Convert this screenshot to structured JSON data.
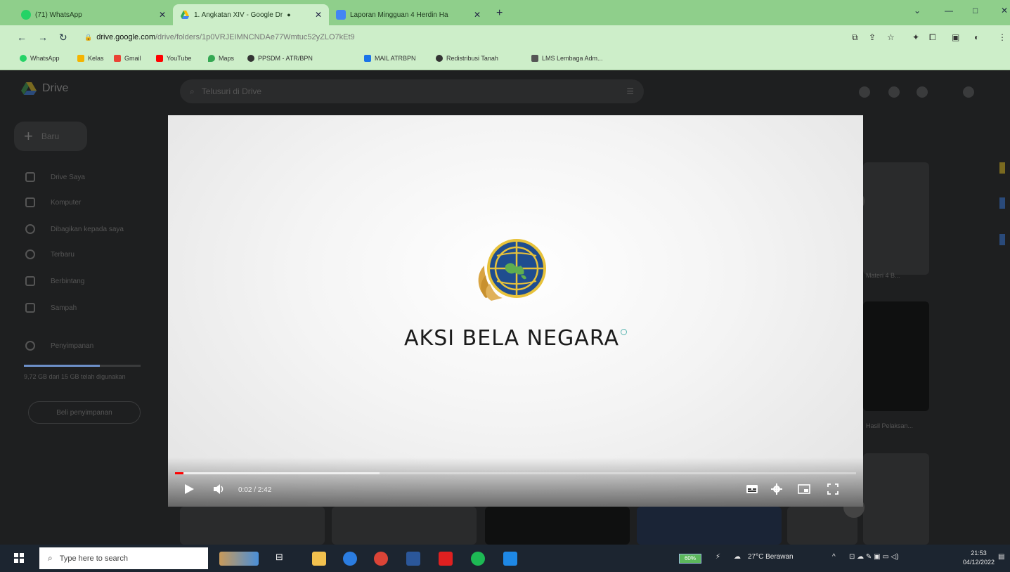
{
  "browser": {
    "tabs": [
      {
        "label": "(71) WhatsApp",
        "active": false
      },
      {
        "label": "1. Angkatan XIV - Google Dr",
        "active": true
      },
      {
        "label": "Laporan Mingguan 4 Herdin Ha",
        "active": false
      }
    ],
    "new_tab": "+",
    "window_controls": {
      "minimize": "—",
      "maximize": "□",
      "close": "✕"
    },
    "url": {
      "host": "drive.google.com",
      "path": "/drive/folders/1p0VRJEIMNCNDAe77Wmtuc52yZLO7kEt9"
    },
    "bookmarks": [
      {
        "label": "WhatsApp",
        "color": "#25d366"
      },
      {
        "label": "Kelas",
        "color": "#f4b400"
      },
      {
        "label": "Gmail",
        "color": "#ea4335"
      },
      {
        "label": "YouTube",
        "color": "#ff0000"
      },
      {
        "label": "Maps",
        "color": "#34a853"
      },
      {
        "label": "PPSDM - ATR/BPN",
        "color": "#333333"
      },
      {
        "label": "MAIL ATRBPN",
        "color": "#1a73e8"
      },
      {
        "label": "Redistribusi Tanah",
        "color": "#333333"
      },
      {
        "label": "LMS Lembaga Adm...",
        "color": "#555555"
      }
    ]
  },
  "drive": {
    "logo_label": "Drive",
    "search_placeholder": "Telusuri di Drive",
    "new_button": "Baru",
    "nav_items": [
      "Drive Saya",
      "Komputer",
      "Dibagikan kepada saya",
      "Terbaru",
      "Berbintang",
      "Sampah"
    ],
    "storage_label": "Penyimpanan",
    "storage_text": "9,72 GB dari 15 GB telah digunakan",
    "storage_button": "Beli penyimpanan",
    "card_labels": [
      "Materi 4 B...",
      "Hasil Pelaksan..."
    ]
  },
  "video": {
    "title": "AKSI BELA NEGARA",
    "time": "0:02 / 2:42",
    "played_fraction": 0.012,
    "buffered_fraction": 0.3
  },
  "taskbar": {
    "search_placeholder": "Type here to search",
    "battery": "60%",
    "weather": "27°C Berawan",
    "time": "21:53",
    "date": "04/12/2022"
  }
}
